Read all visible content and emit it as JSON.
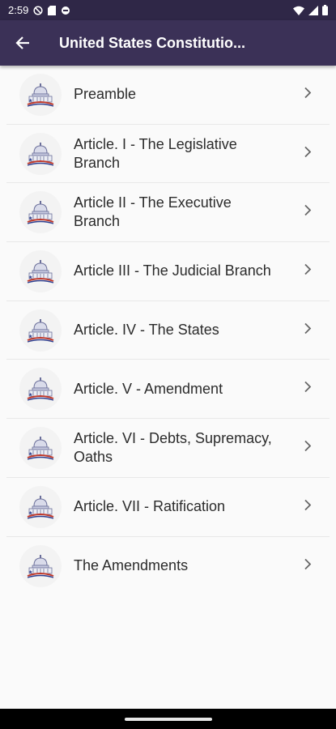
{
  "status_bar": {
    "time": "2:59",
    "left_icons": [
      "do-not-disturb-icon",
      "sd-card-icon",
      "circle-status-icon"
    ],
    "right_icons": [
      "wifi-icon",
      "signal-icon",
      "battery-icon"
    ]
  },
  "app_bar": {
    "back_icon": "arrow-left-icon",
    "title": "United States Constitutio..."
  },
  "items": [
    {
      "label": "Preamble"
    },
    {
      "label": "Article. I - The Legislative Branch"
    },
    {
      "label": "Article II - The Executive Branch"
    },
    {
      "label": "Article III - The Judicial Branch"
    },
    {
      "label": "Article. IV - The States"
    },
    {
      "label": "Article. V - Amendment"
    },
    {
      "label": "Article. VI - Debts, Supremacy, Oaths"
    },
    {
      "label": "Article. VII - Ratification"
    },
    {
      "label": "The Amendments"
    }
  ],
  "colors": {
    "status_bar": "#2f2747",
    "app_bar": "#3b3157",
    "background": "#fafafa"
  }
}
